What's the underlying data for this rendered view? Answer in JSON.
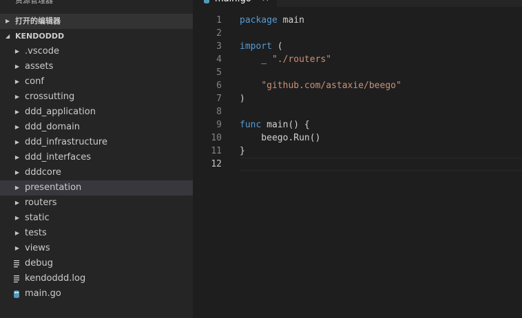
{
  "explorer": {
    "title": "资源管理器",
    "open_editors_label": "打开的编辑器",
    "project_label": "KENDODDD",
    "items": [
      {
        "label": ".vscode",
        "kind": "folder"
      },
      {
        "label": "assets",
        "kind": "folder"
      },
      {
        "label": "conf",
        "kind": "folder"
      },
      {
        "label": "crossutting",
        "kind": "folder"
      },
      {
        "label": "ddd_application",
        "kind": "folder"
      },
      {
        "label": "ddd_domain",
        "kind": "folder"
      },
      {
        "label": "ddd_infrastructure",
        "kind": "folder"
      },
      {
        "label": "ddd_interfaces",
        "kind": "folder"
      },
      {
        "label": "dddcore",
        "kind": "folder"
      },
      {
        "label": "presentation",
        "kind": "folder",
        "selected": true
      },
      {
        "label": "routers",
        "kind": "folder"
      },
      {
        "label": "static",
        "kind": "folder"
      },
      {
        "label": "tests",
        "kind": "folder"
      },
      {
        "label": "views",
        "kind": "folder"
      },
      {
        "label": "debug",
        "kind": "text-file"
      },
      {
        "label": "kendoddd.log",
        "kind": "text-file"
      },
      {
        "label": "main.go",
        "kind": "go-file"
      }
    ]
  },
  "tab": {
    "label": "main.go",
    "close": "✕"
  },
  "editor": {
    "current_line": 12,
    "lines": [
      {
        "n": "1",
        "tokens": [
          [
            "kw",
            "package"
          ],
          [
            "plain",
            " main"
          ]
        ]
      },
      {
        "n": "2",
        "tokens": []
      },
      {
        "n": "3",
        "tokens": [
          [
            "kw",
            "import"
          ],
          [
            "plain",
            " ("
          ]
        ]
      },
      {
        "n": "4",
        "tokens": [
          [
            "plain",
            "    _ "
          ],
          [
            "str",
            "\"./routers\""
          ]
        ]
      },
      {
        "n": "5",
        "tokens": []
      },
      {
        "n": "6",
        "tokens": [
          [
            "plain",
            "    "
          ],
          [
            "str",
            "\"github.com/astaxie/beego\""
          ]
        ]
      },
      {
        "n": "7",
        "tokens": [
          [
            "plain",
            ")"
          ]
        ]
      },
      {
        "n": "8",
        "tokens": []
      },
      {
        "n": "9",
        "tokens": [
          [
            "kw",
            "func"
          ],
          [
            "plain",
            " main() {"
          ]
        ]
      },
      {
        "n": "10",
        "tokens": [
          [
            "plain",
            "    beego.Run()"
          ]
        ]
      },
      {
        "n": "11",
        "tokens": [
          [
            "plain",
            "}"
          ]
        ]
      },
      {
        "n": "12",
        "tokens": []
      }
    ]
  },
  "colors": {
    "keyword": "#569cd6",
    "string": "#ce9178",
    "sidebar_bg": "#252526",
    "editor_bg": "#1e1e1e",
    "selection_bg": "#37373d",
    "go_icon": "#519aba"
  }
}
